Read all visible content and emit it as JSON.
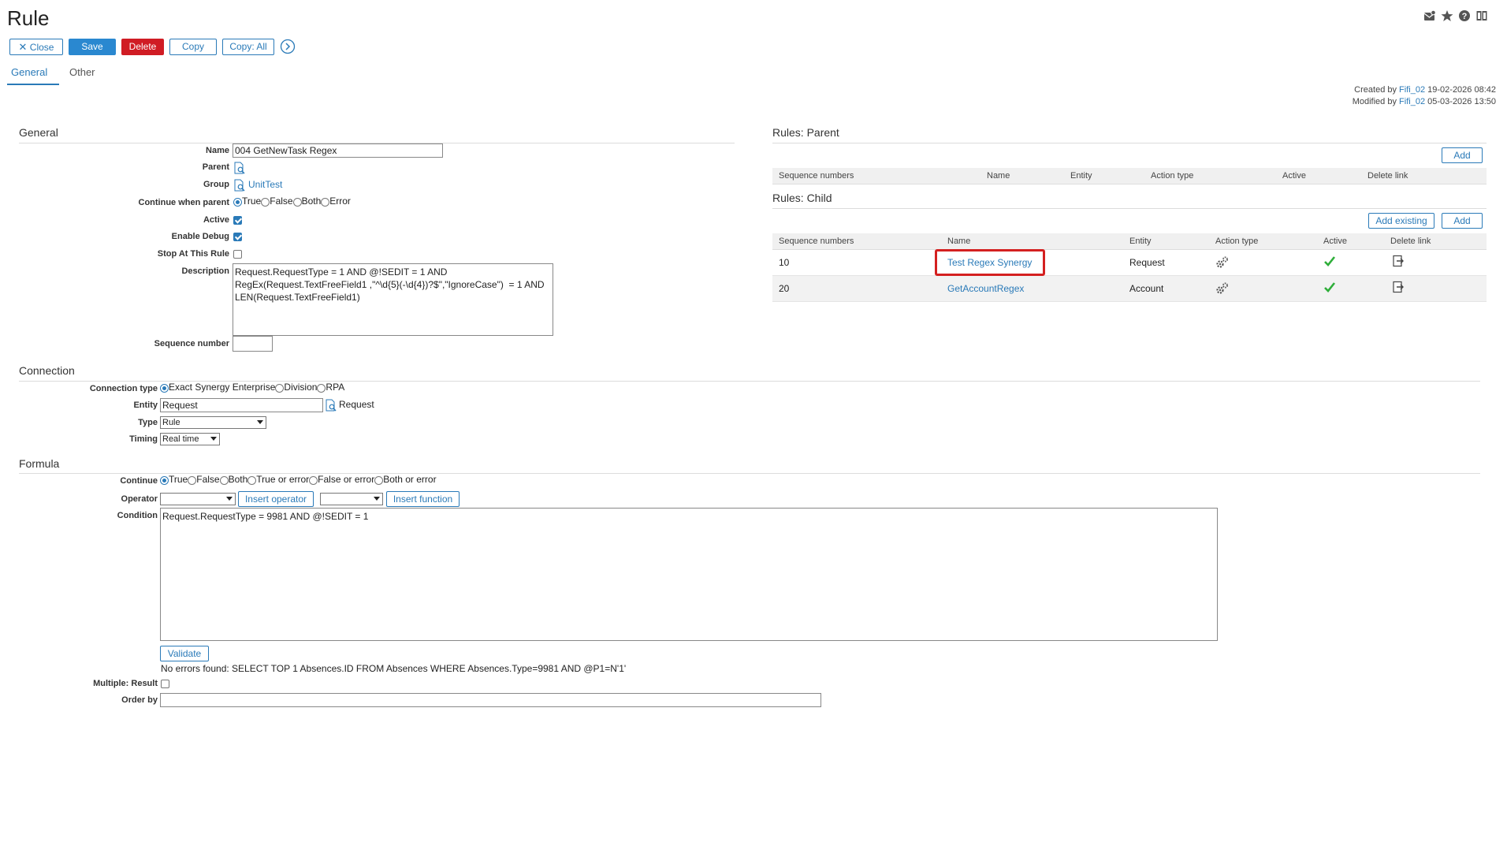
{
  "header": {
    "title": "Rule",
    "icons": [
      "envelope-icon",
      "star-icon",
      "help-icon",
      "book-icon"
    ]
  },
  "toolbar": {
    "close_label": "Close",
    "save_label": "Save",
    "delete_label": "Delete",
    "copy_label": "Copy",
    "copy_all_label": "Copy: All"
  },
  "tabs": [
    {
      "label": "General",
      "active": true
    },
    {
      "label": "Other",
      "active": false
    }
  ],
  "meta": {
    "created_prefix": "Created by",
    "created_user": "Fifi_02",
    "created_date": "19-02-2026 08:42",
    "modified_prefix": "Modified by",
    "modified_user": "Fifi_02",
    "modified_date": "05-03-2026 13:50"
  },
  "general": {
    "section_title": "General",
    "name_label": "Name",
    "name_value": "004 GetNewTask Regex",
    "parent_label": "Parent",
    "group_label": "Group",
    "group_value": "UnitTest",
    "continue_label": "Continue when parent",
    "continue_options": [
      "True",
      "False",
      "Both",
      "Error"
    ],
    "continue_selected": "True",
    "active_label": "Active",
    "active_checked": true,
    "debug_label": "Enable Debug",
    "debug_checked": true,
    "stop_label": "Stop At This Rule",
    "stop_checked": false,
    "description_label": "Description",
    "description_value": "Request.RequestType = 1 AND @!SEDIT = 1 AND\nRegEx(Request.TextFreeField1 ,\"^\\d{5}(-\\d{4})?$\",\"IgnoreCase\")  = 1 AND\nLEN(Request.TextFreeField1)",
    "sequence_label": "Sequence number",
    "sequence_value": ""
  },
  "connection": {
    "section_title": "Connection",
    "type_label": "Connection type",
    "type_options": [
      "Exact Synergy Enterprise",
      "Division",
      "RPA"
    ],
    "type_selected": "Exact Synergy Enterprise",
    "entity_label": "Entity",
    "entity_value": "Request",
    "entity_lookup_text": "Request",
    "kind_label": "Type",
    "kind_value": "Rule",
    "timing_label": "Timing",
    "timing_value": "Real time"
  },
  "formula": {
    "section_title": "Formula",
    "continue_label": "Continue",
    "continue_options": [
      "True",
      "False",
      "Both",
      "True or error",
      "False or error",
      "Both or error"
    ],
    "continue_selected": "True",
    "operator_label": "Operator",
    "insert_operator_label": "Insert operator",
    "insert_function_label": "Insert function",
    "condition_label": "Condition",
    "condition_value": "Request.RequestType = 9981 AND @!SEDIT = 1",
    "validate_label": "Validate",
    "validation_message": "No errors found: SELECT TOP 1 Absences.ID FROM Absences WHERE Absences.Type=9981 AND @P1=N'1'",
    "multiple_label": "Multiple: Result",
    "multiple_checked": false,
    "order_label": "Order by",
    "order_value": ""
  },
  "rules_parent": {
    "title": "Rules: Parent",
    "add_label": "Add",
    "columns": [
      "Sequence numbers",
      "Name",
      "Entity",
      "Action type",
      "Active",
      "Delete link"
    ]
  },
  "rules_child": {
    "title": "Rules: Child",
    "add_existing_label": "Add existing",
    "add_label": "Add",
    "columns": [
      "Sequence numbers",
      "Name",
      "Entity",
      "Action type",
      "Active",
      "Delete link"
    ],
    "rows": [
      {
        "seq": "10",
        "name": "Test Regex Synergy",
        "entity": "Request",
        "highlighted": true
      },
      {
        "seq": "20",
        "name": "GetAccountRegex",
        "entity": "Account",
        "highlighted": false
      }
    ]
  },
  "colors": {
    "accent": "#2a7ab8",
    "primary_button": "#2a88d0",
    "danger_button": "#d01c24",
    "highlight": "#d42020",
    "check_green": "#2fae3a"
  }
}
